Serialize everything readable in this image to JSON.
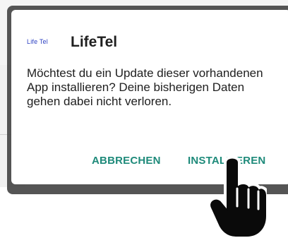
{
  "dialog": {
    "app_logo_text": "Life Tel",
    "title": "LifeTel",
    "message": "Möchtest du ein Update dieser vorhandenen App installieren? Deine bisherigen Daten gehen dabei nicht verloren.",
    "buttons": {
      "cancel_label": "ABBRECHEN",
      "install_label": "INSTALLIEREN"
    }
  },
  "colors": {
    "accent": "#1e8a7a",
    "logo": "#2b3fc2",
    "shadow": "#464646"
  },
  "icons": {
    "pointer": "hand-pointer-icon"
  }
}
